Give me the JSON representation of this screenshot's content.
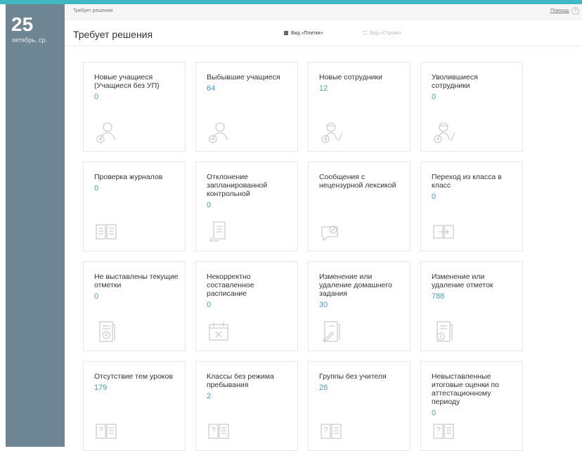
{
  "sidebar": {
    "day": "25",
    "date_sub": "октябрь, ср."
  },
  "breadcrumb": "Требует решения",
  "help_label": "Помощь",
  "help_icon_label": "?",
  "page_title": "Требует решения",
  "view_tiles_label": "Вид «Плитки»",
  "view_rows_label": "Вид «Строки»",
  "tiles": [
    {
      "title": "Новые учащиеся (Учащиеся без УП)",
      "count": "0",
      "icon": "student-add-icon"
    },
    {
      "title": "Выбывшие учащиеся",
      "count": "64",
      "icon": "student-remove-icon"
    },
    {
      "title": "Новые сотрудники",
      "count": "12",
      "icon": "employee-add-icon"
    },
    {
      "title": "Уволившиеся сотрудники",
      "count": "0",
      "icon": "employee-remove-icon"
    },
    {
      "title": "Проверка журналов",
      "count": "0",
      "icon": "journal-icon"
    },
    {
      "title": "Отклонение запланированной контрольной",
      "count": "0",
      "icon": "document-return-icon"
    },
    {
      "title": "Сообщения с нецензурной лексикой",
      "count": "",
      "icon": "message-blocked-icon"
    },
    {
      "title": "Переход из класса в класс",
      "count": "0",
      "icon": "class-transfer-icon"
    },
    {
      "title": "Не выставлены текущие отметки",
      "count": "0",
      "icon": "marks-missing-icon"
    },
    {
      "title": "Некорректно составленное расписание",
      "count": "0",
      "icon": "calendar-error-icon"
    },
    {
      "title": "Изменение или удаление домашнего задания",
      "count": "30",
      "icon": "homework-edit-icon"
    },
    {
      "title": "Изменение или удаление отметок",
      "count": "788",
      "icon": "marks-edit-icon"
    },
    {
      "title": "Отсутствие тем уроков",
      "count": "179",
      "icon": "book-question-icon"
    },
    {
      "title": "Классы без режима пребывания",
      "count": "2",
      "icon": "book-question-icon"
    },
    {
      "title": "Группы без учителя",
      "count": "26",
      "icon": "book-question-icon"
    },
    {
      "title": "Невыставленные итоговые оценки по аттестационному периоду",
      "count": "0",
      "icon": "book-question-icon"
    }
  ]
}
